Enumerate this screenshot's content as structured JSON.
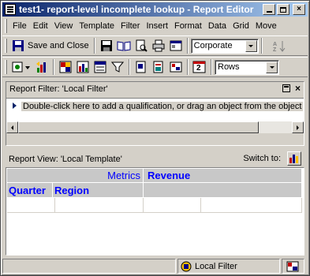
{
  "window": {
    "title": "test1- report-level incomplete lookup - Report Editor",
    "controls": {
      "minimize": "_",
      "maximize": "□",
      "close": "×"
    }
  },
  "menu": [
    {
      "label": "File",
      "u": "F",
      "rest": "ile"
    },
    {
      "label": "Edit",
      "u": "E",
      "rest": "dit"
    },
    {
      "label": "View",
      "u": "V",
      "rest": "iew"
    },
    {
      "label": "Template",
      "u": "T",
      "rest": "emplate"
    },
    {
      "label": "Filter",
      "u": "",
      "rest": ""
    },
    {
      "label": "Insert",
      "u": "I",
      "rest": "nsert"
    },
    {
      "label": "Format",
      "u": "",
      "rest": ""
    },
    {
      "label": "Data",
      "u": "D",
      "rest": "ata"
    },
    {
      "label": "Grid",
      "u": "G",
      "rest": "rid"
    },
    {
      "label": "Move",
      "u": "M",
      "rest": "ove"
    }
  ],
  "menu_labels": {
    "file": "File",
    "edit": "Edit",
    "view": "View",
    "template": "Template",
    "filter": "Filter",
    "insert": "Insert",
    "format": "Format",
    "data": "Data",
    "grid": "Grid",
    "move": "Move"
  },
  "toolbar1": {
    "save_close_label": "Save and Close",
    "style_combo_value": "Corporate",
    "icons": [
      "save-and-close-icon",
      "save-icon",
      "open-book-icon",
      "print-preview-icon",
      "print-icon",
      "properties-icon",
      "sort-az-icon"
    ]
  },
  "toolbar2": {
    "rows_combo_value": "Rows",
    "icons": [
      "sql-view-icon",
      "grid-graph-icon",
      "grid-view-icon",
      "graph-view-icon",
      "object-browser-icon",
      "new-object-icon",
      "report-icon",
      "filter-icon",
      "schedule-icon"
    ]
  },
  "filter_panel": {
    "title": "Report Filter: 'Local Filter'",
    "hint": "Double-click here to add a qualification, or drag an object from the object"
  },
  "view_panel": {
    "title": "Report View: 'Local Template'",
    "switch_label": "Switch to:"
  },
  "grid": {
    "metrics_label": "Metrics",
    "column_header": "Revenue",
    "row_headers": [
      "Quarter",
      "Region"
    ]
  },
  "status_bar": {
    "filter_label": "Local Filter"
  },
  "colors": {
    "title_start": "#0a246a",
    "title_end": "#a6caf0",
    "grid_header_text": "#0000ff",
    "grid_header_bg": "#c8c8c8",
    "chrome": "#d4d0c8"
  }
}
